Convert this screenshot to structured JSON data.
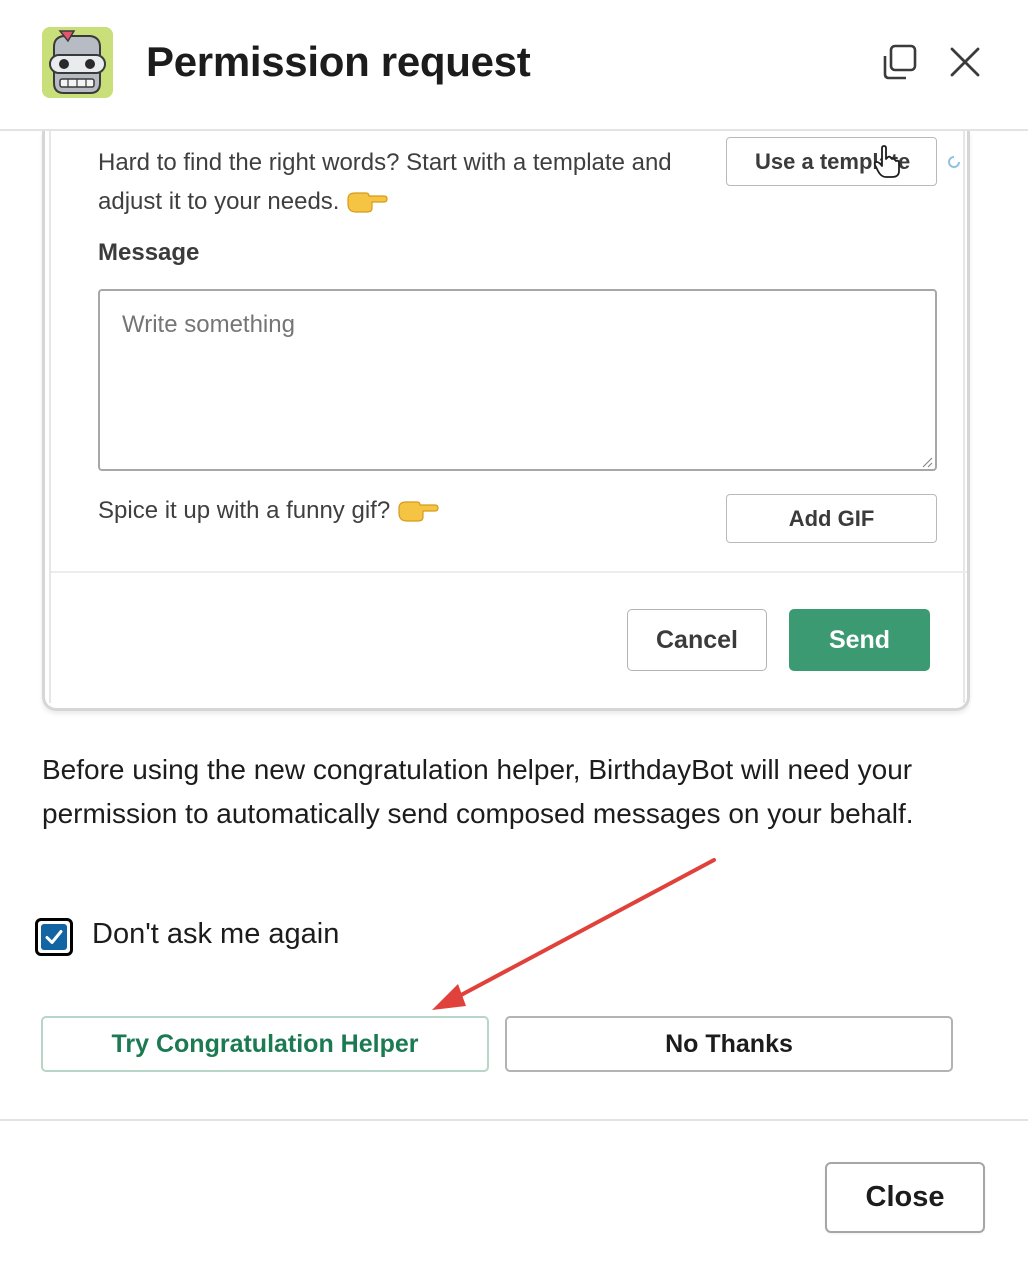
{
  "header": {
    "title": "Permission request",
    "avatar_icon": "robot-bot-icon",
    "copy_icon": "copy-icon",
    "close_icon": "close-icon"
  },
  "embed": {
    "template_text": "Hard to find the right words? Start with a template and adjust it to your needs.",
    "template_button_label": "Use a template",
    "message_label": "Message",
    "message_placeholder": "Write something",
    "message_value": "",
    "gif_text": "Spice it up with a funny gif?",
    "gif_button_label": "Add GIF",
    "cancel_label": "Cancel",
    "send_label": "Send",
    "send_color": "#3c9a73"
  },
  "description": "Before using the new congratulation helper, BirthdayBot will need your permission to automatically send composed messages on your behalf.",
  "checkbox": {
    "label": "Don't ask me again",
    "checked": true,
    "color": "#1264a3"
  },
  "annotation": {
    "arrow_color": "#e0413a"
  },
  "actions": {
    "try_label": "Try Congratulation Helper",
    "try_color": "#1c7a52",
    "no_label": "No Thanks"
  },
  "footer": {
    "close_label": "Close"
  }
}
